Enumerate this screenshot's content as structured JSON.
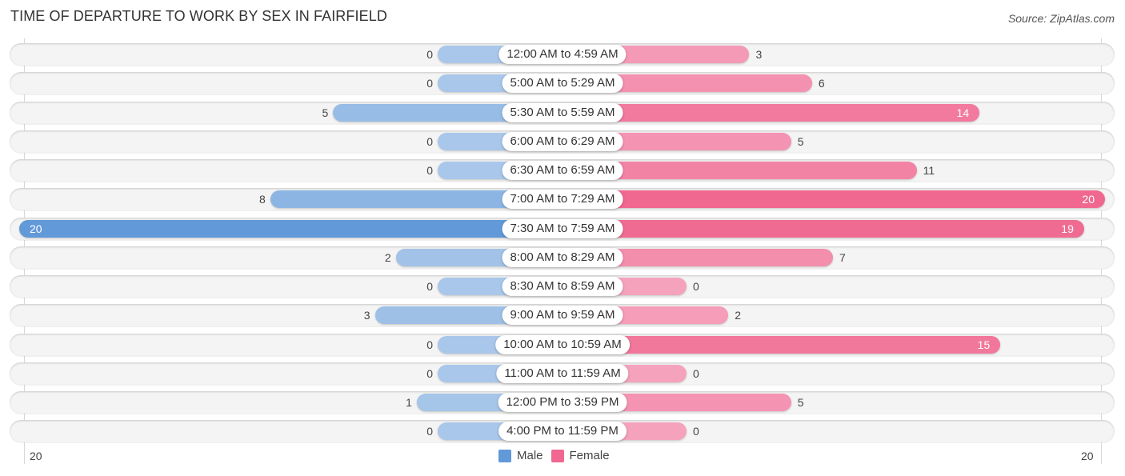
{
  "header": {
    "title": "TIME OF DEPARTURE TO WORK BY SEX IN FAIRFIELD",
    "source": "Source: ZipAtlas.com"
  },
  "colors": {
    "male_strong": "#6199d9",
    "male_light": "#a9c7ea",
    "female_strong": "#f06890",
    "female_light": "#f5a3bd",
    "track": "#f4f4f4"
  },
  "chart_data": {
    "type": "bar",
    "orientation": "horizontal-diverging",
    "title": "TIME OF DEPARTURE TO WORK BY SEX IN FAIRFIELD",
    "categories": [
      "12:00 AM to 4:59 AM",
      "5:00 AM to 5:29 AM",
      "5:30 AM to 5:59 AM",
      "6:00 AM to 6:29 AM",
      "6:30 AM to 6:59 AM",
      "7:00 AM to 7:29 AM",
      "7:30 AM to 7:59 AM",
      "8:00 AM to 8:29 AM",
      "8:30 AM to 8:59 AM",
      "9:00 AM to 9:59 AM",
      "10:00 AM to 10:59 AM",
      "11:00 AM to 11:59 AM",
      "12:00 PM to 3:59 PM",
      "4:00 PM to 11:59 PM"
    ],
    "series": [
      {
        "name": "Male",
        "values": [
          0,
          0,
          5,
          0,
          0,
          8,
          20,
          2,
          0,
          3,
          0,
          0,
          1,
          0
        ]
      },
      {
        "name": "Female",
        "values": [
          3,
          6,
          14,
          5,
          11,
          20,
          19,
          7,
          0,
          2,
          15,
          0,
          5,
          0
        ]
      }
    ],
    "axis_max": 20,
    "tick_labels": {
      "left": "20",
      "right": "20"
    },
    "legend": {
      "position": "bottom-center",
      "entries": [
        "Male",
        "Female"
      ]
    }
  }
}
